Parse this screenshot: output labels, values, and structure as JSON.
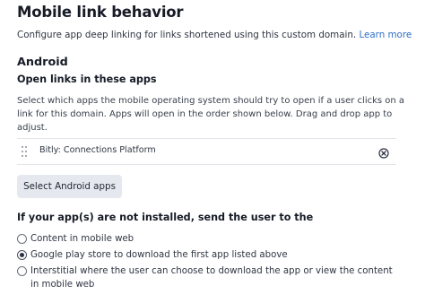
{
  "header": {
    "title": "Mobile link behavior",
    "subtitle": "Configure app deep linking for links shortened using this custom domain.",
    "learn_more": "Learn more"
  },
  "android": {
    "section_title": "Android",
    "open_links_heading": "Open links in these apps",
    "description": "Select which apps the mobile operating system should try to open if a user clicks on a link for this domain. Apps will open in the order shown below. Drag and drop app to adjust.",
    "apps": [
      {
        "name": "Bitly: Connections Platform",
        "handle_icon": "drag-handle-icon",
        "remove_icon": "close-circle-icon"
      }
    ],
    "select_button": "Select Android apps"
  },
  "fallback": {
    "heading": "If your app(s) are not installed, send the user to the",
    "options": [
      {
        "label": "Content in mobile web",
        "selected": false
      },
      {
        "label": "Google play store to download the first app listed above",
        "selected": true
      },
      {
        "label": "Interstitial where the user can choose to download the app or view the content in mobile web",
        "selected": false
      }
    ]
  },
  "colors": {
    "link": "#2f6fc7",
    "button_bg": "#e5e9ef",
    "text": "#1f2430"
  }
}
